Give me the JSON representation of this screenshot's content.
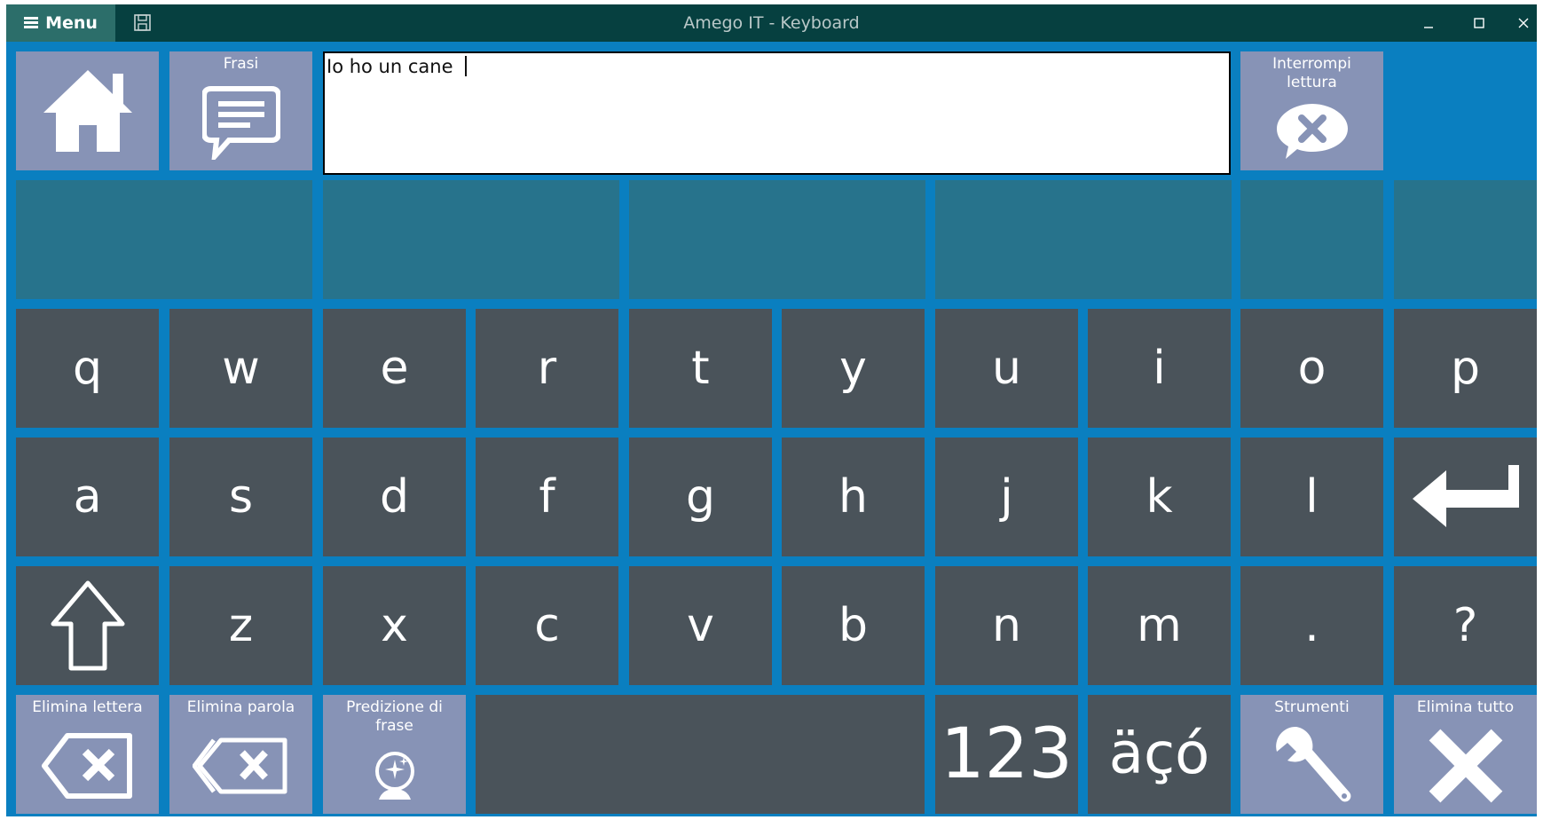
{
  "window": {
    "title": "Amego IT - Keyboard",
    "menu_label": "Menu",
    "controls": {
      "minimize": "minimize-icon",
      "maximize": "maximize-icon",
      "close": "close-icon"
    }
  },
  "top": {
    "home_icon": "home-icon",
    "phrases_label": "Frasi",
    "text_value": "Io ho un cane ",
    "stop_reading_label": "Interrompi lettura"
  },
  "keys": {
    "row1": [
      "q",
      "w",
      "e",
      "r",
      "t",
      "y",
      "u",
      "i",
      "o",
      "p"
    ],
    "row2": [
      "a",
      "s",
      "d",
      "f",
      "g",
      "h",
      "j",
      "k",
      "l"
    ],
    "row3": [
      "z",
      "x",
      "c",
      "v",
      "b",
      "n",
      "m",
      ".",
      "?"
    ],
    "numbers": "123",
    "accents": "äçó"
  },
  "bottom": {
    "delete_letter": "Elimina lettera",
    "delete_word": "Elimina parola",
    "sentence_prediction": "Predizione di frase",
    "tools": "Strumenti",
    "delete_all": "Elimina tutto"
  },
  "colors": {
    "background": "#0a7fc0",
    "titlebar": "#064040",
    "key": "#4a535a",
    "function_key": "#8793b6",
    "prediction_slot": "#27738c"
  }
}
